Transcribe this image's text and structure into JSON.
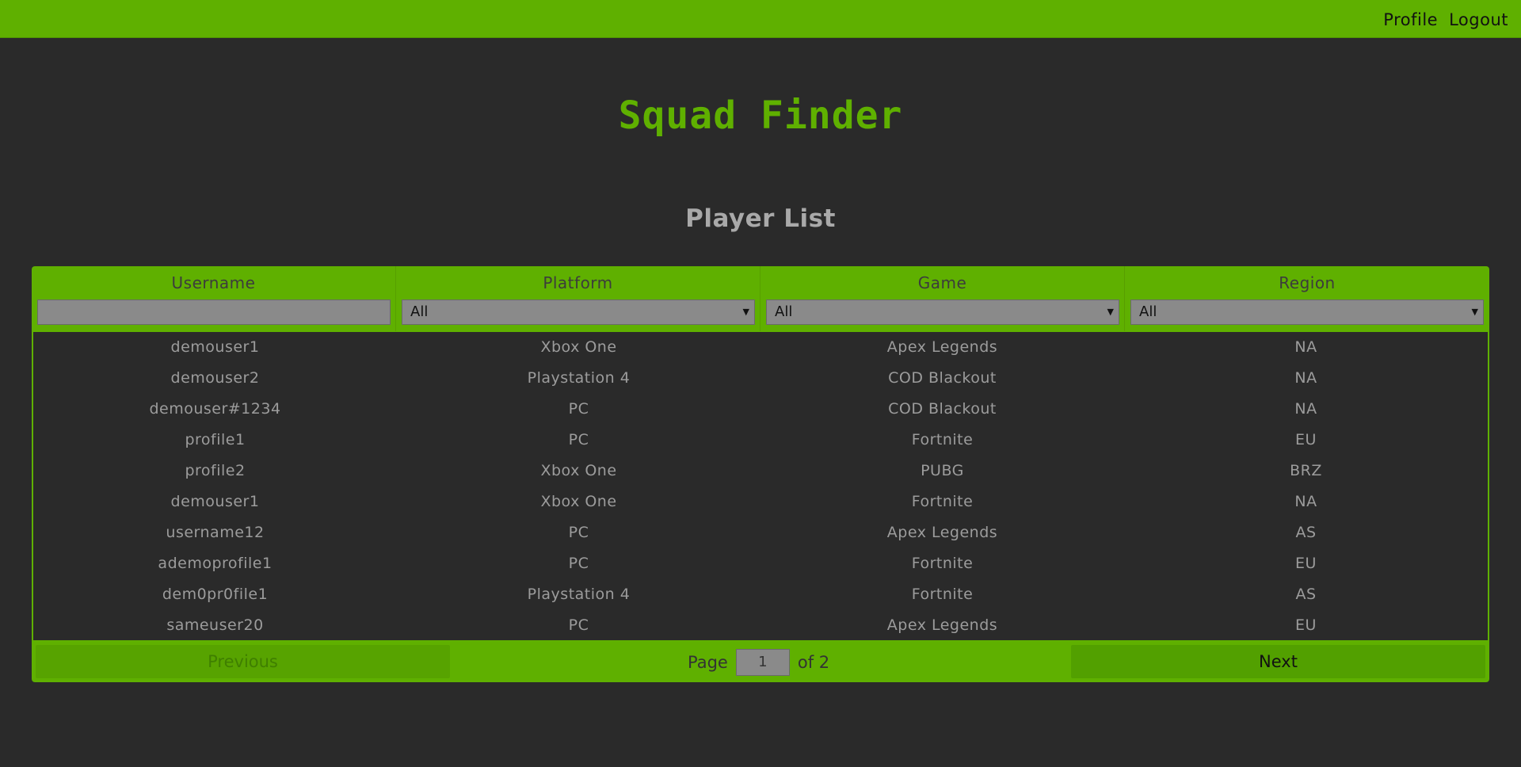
{
  "nav": {
    "profile": "Profile",
    "logout": "Logout"
  },
  "app": {
    "title": "Squad Finder"
  },
  "page": {
    "title": "Player List"
  },
  "table": {
    "headers": [
      "Username",
      "Platform",
      "Game",
      "Region"
    ],
    "filters": {
      "username": "",
      "platform": "All",
      "game": "All",
      "region": "All"
    },
    "rows": [
      [
        "demouser1",
        "Xbox One",
        "Apex Legends",
        "NA"
      ],
      [
        "demouser2",
        "Playstation 4",
        "COD Blackout",
        "NA"
      ],
      [
        "demouser#1234",
        "PC",
        "COD Blackout",
        "NA"
      ],
      [
        "profile1",
        "PC",
        "Fortnite",
        "EU"
      ],
      [
        "profile2",
        "Xbox One",
        "PUBG",
        "BRZ"
      ],
      [
        "demouser1",
        "Xbox One",
        "Fortnite",
        "NA"
      ],
      [
        "username12",
        "PC",
        "Apex Legends",
        "AS"
      ],
      [
        "ademoprofile1",
        "PC",
        "Fortnite",
        "EU"
      ],
      [
        "dem0pr0file1",
        "Playstation 4",
        "Fortnite",
        "AS"
      ],
      [
        "sameuser20",
        "PC",
        "Apex Legends",
        "EU"
      ]
    ]
  },
  "pager": {
    "previous": "Previous",
    "page_label": "Page",
    "current_page": "1",
    "of_label": "of 2",
    "next": "Next"
  },
  "colors": {
    "accent": "#5fb000",
    "background": "#2a2a2a",
    "text": "#9c9c9c"
  }
}
